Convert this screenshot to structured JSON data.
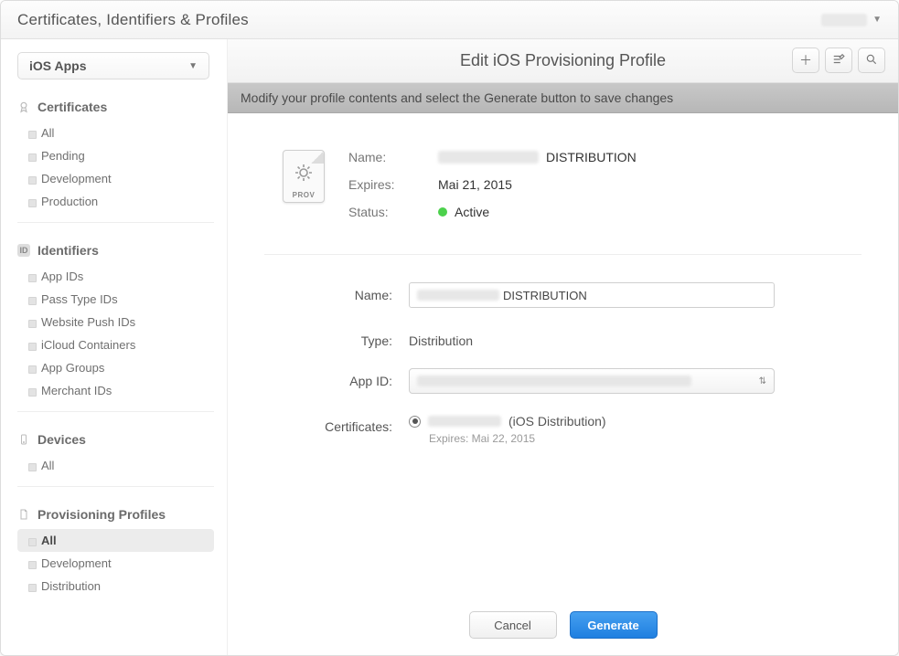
{
  "header": {
    "title": "Certificates, Identifiers & Profiles",
    "account_name": ""
  },
  "sidebar": {
    "platform_label": "iOS Apps",
    "sections": {
      "certificates": {
        "label": "Certificates",
        "items": [
          "All",
          "Pending",
          "Development",
          "Production"
        ]
      },
      "identifiers": {
        "label": "Identifiers",
        "items": [
          "App IDs",
          "Pass Type IDs",
          "Website Push IDs",
          "iCloud Containers",
          "App Groups",
          "Merchant IDs"
        ]
      },
      "devices": {
        "label": "Devices",
        "items": [
          "All"
        ]
      },
      "profiles": {
        "label": "Provisioning Profiles",
        "items": [
          "All",
          "Development",
          "Distribution"
        ],
        "active": "All"
      }
    }
  },
  "main": {
    "title": "Edit iOS Provisioning Profile",
    "subheader": "Modify your profile contents and select the Generate button to save changes",
    "prov_icon_label": "PROV"
  },
  "summary": {
    "labels": {
      "name": "Name:",
      "expires": "Expires:",
      "status": "Status:"
    },
    "name_suffix": "DISTRIBUTION",
    "expires": "Mai 21, 2015",
    "status": "Active",
    "status_color": "#4cd14c"
  },
  "form": {
    "labels": {
      "name": "Name:",
      "type": "Type:",
      "app_id": "App ID:",
      "certificates": "Certificates:"
    },
    "name_value_suffix": "DISTRIBUTION",
    "type_value": "Distribution",
    "app_id_value": "",
    "cert_suffix": "(iOS Distribution)",
    "cert_expires_label": "Expires: Mai 22, 2015"
  },
  "buttons": {
    "cancel": "Cancel",
    "generate": "Generate"
  }
}
